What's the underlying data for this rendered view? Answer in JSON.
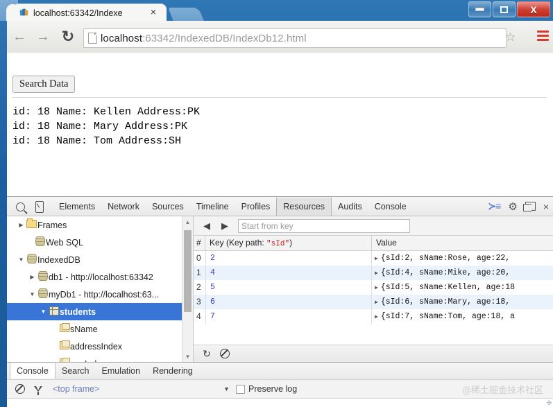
{
  "window": {
    "minimize_label": "Minimize",
    "maximize_label": "Maximize",
    "close_label": "X"
  },
  "tab": {
    "title": "localhost:63342/Indexe",
    "close_label": "×"
  },
  "toolbar": {
    "back_glyph": "←",
    "forward_glyph": "→",
    "reload_glyph": "↻",
    "star_glyph": "☆",
    "url_host": "localhost",
    "url_rest": ":63342/IndexedDB/IndexDb12.html"
  },
  "page": {
    "search_button": "Search Data",
    "output_lines": "id: 18 Name: Kellen Address:PK\nid: 18 Name: Mary Address:PK\nid: 18 Name: Tom Address:SH"
  },
  "devtools": {
    "tabs": [
      {
        "label": "Elements",
        "active": false
      },
      {
        "label": "Network",
        "active": false
      },
      {
        "label": "Sources",
        "active": false
      },
      {
        "label": "Timeline",
        "active": false
      },
      {
        "label": "Profiles",
        "active": false
      },
      {
        "label": "Resources",
        "active": true
      },
      {
        "label": "Audits",
        "active": false
      },
      {
        "label": "Console",
        "active": false
      }
    ],
    "drawer_toggle_glyph": "≻≡",
    "settings_glyph": "⚙",
    "close_glyph": "×"
  },
  "tree": {
    "items": [
      {
        "label": "Frames",
        "icon": "folder-icon",
        "twisty": "▶",
        "indent": 14,
        "selected": false
      },
      {
        "label": "Web SQL",
        "icon": "database-icon",
        "twisty": "",
        "indent": 26,
        "selected": false
      },
      {
        "label": "IndexedDB",
        "icon": "database-icon",
        "twisty": "▼",
        "indent": 14,
        "selected": false
      },
      {
        "label": "db1 - http://localhost:63342",
        "icon": "database-icon",
        "twisty": "▶",
        "indent": 30,
        "selected": false
      },
      {
        "label": "myDb1 - http://localhost:63...",
        "icon": "database-icon",
        "twisty": "▼",
        "indent": 30,
        "selected": false
      },
      {
        "label": "students",
        "icon": "object-store-icon",
        "twisty": "▼",
        "indent": 46,
        "selected": true
      },
      {
        "label": "sName",
        "icon": "index-icon",
        "twisty": "",
        "indent": 74,
        "selected": false
      },
      {
        "label": "addressIndex",
        "icon": "index-icon",
        "twisty": "",
        "indent": 74,
        "selected": false
      },
      {
        "label": "ageIndex",
        "icon": "index-icon",
        "twisty": "",
        "indent": 74,
        "selected": false
      }
    ],
    "scroll_up_glyph": "▲",
    "scroll_down_glyph": "▼"
  },
  "datagrid": {
    "prev_glyph": "◀",
    "next_glyph": "▶",
    "start_from_key_placeholder": "Start from key",
    "start_from_key_value": "",
    "columns": {
      "index": "#",
      "key_prefix": "Key (Key path: ",
      "key_path": "\"sId\"",
      "key_suffix": ")",
      "value": "Value"
    },
    "rows": [
      {
        "index": "0",
        "key": "2",
        "value": "{sId:2, sName:Rose, age:22,"
      },
      {
        "index": "1",
        "key": "4",
        "value": "{sId:4, sName:Mike, age:20,"
      },
      {
        "index": "2",
        "key": "5",
        "value": "{sId:5, sName:Kellen, age:18"
      },
      {
        "index": "3",
        "key": "6",
        "value": "{sId:6, sName:Mary, age:18,"
      },
      {
        "index": "4",
        "key": "7",
        "value": "{sId:7, sName:Tom, age:18, a"
      }
    ],
    "disclosure_glyph": "▶",
    "refresh_glyph": "↻",
    "clear_label": "Clear"
  },
  "drawer": {
    "tabs": [
      {
        "label": "Console",
        "active": true
      },
      {
        "label": "Search",
        "active": false
      },
      {
        "label": "Emulation",
        "active": false
      },
      {
        "label": "Rendering",
        "active": false
      }
    ],
    "clear_label": "Clear console",
    "filter_label": "Filter",
    "frame_selector": "<top frame>",
    "frame_caret": "▼",
    "preserve_log": "Preserve log",
    "watermark": "@稀土掘金技术社区"
  }
}
